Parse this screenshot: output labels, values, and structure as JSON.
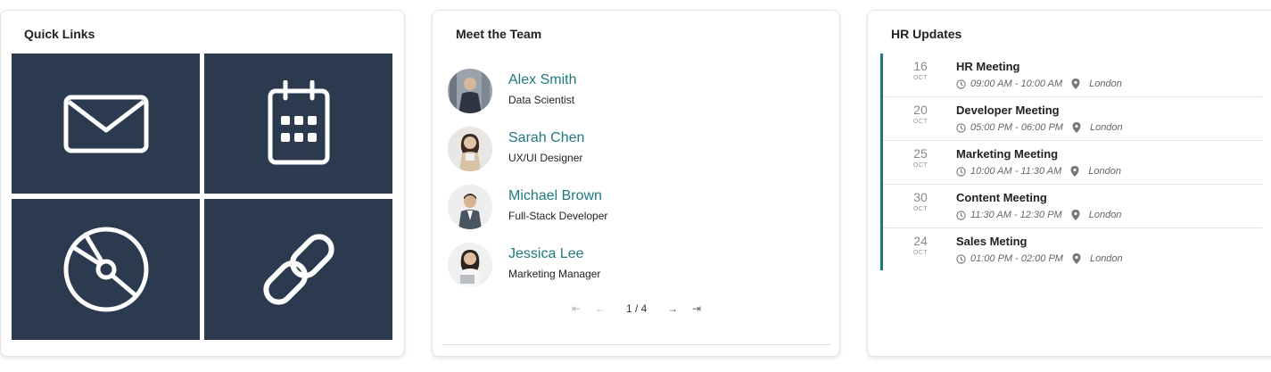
{
  "quick_links": {
    "title": "Quick Links",
    "tiles": [
      {
        "icon": "mail-icon"
      },
      {
        "icon": "calendar-icon"
      },
      {
        "icon": "disc-icon"
      },
      {
        "icon": "link-icon"
      }
    ],
    "tile_color": "#2b3a4e"
  },
  "team": {
    "title": "Meet the Team",
    "members": [
      {
        "name": "Alex Smith",
        "role": "Data Scientist"
      },
      {
        "name": "Sarah Chen",
        "role": "UX/UI Designer"
      },
      {
        "name": "Michael Brown",
        "role": "Full-Stack Developer"
      },
      {
        "name": "Jessica Lee",
        "role": "Marketing Manager"
      }
    ],
    "pager": {
      "info": "1 / 4",
      "first": "⇤",
      "prev": "←",
      "next": "→",
      "last": "⇥"
    },
    "accent": "#1f7a80"
  },
  "hr": {
    "title": "HR Updates",
    "events": [
      {
        "day": "16",
        "month": "OCT",
        "title": "HR Meeting",
        "time": "09:00 AM - 10:00 AM",
        "location": "London"
      },
      {
        "day": "20",
        "month": "OCT",
        "title": "Developer Meeting",
        "time": "05:00 PM - 06:00 PM",
        "location": "London"
      },
      {
        "day": "25",
        "month": "OCT",
        "title": "Marketing Meeting",
        "time": "10:00 AM - 11:30 AM",
        "location": "London"
      },
      {
        "day": "30",
        "month": "OCT",
        "title": "Content Meeting",
        "time": "11:30 AM - 12:30 PM",
        "location": "London"
      },
      {
        "day": "24",
        "month": "OCT",
        "title": "Sales Meting",
        "time": "01:00 PM - 02:00 PM",
        "location": "London"
      }
    ]
  }
}
